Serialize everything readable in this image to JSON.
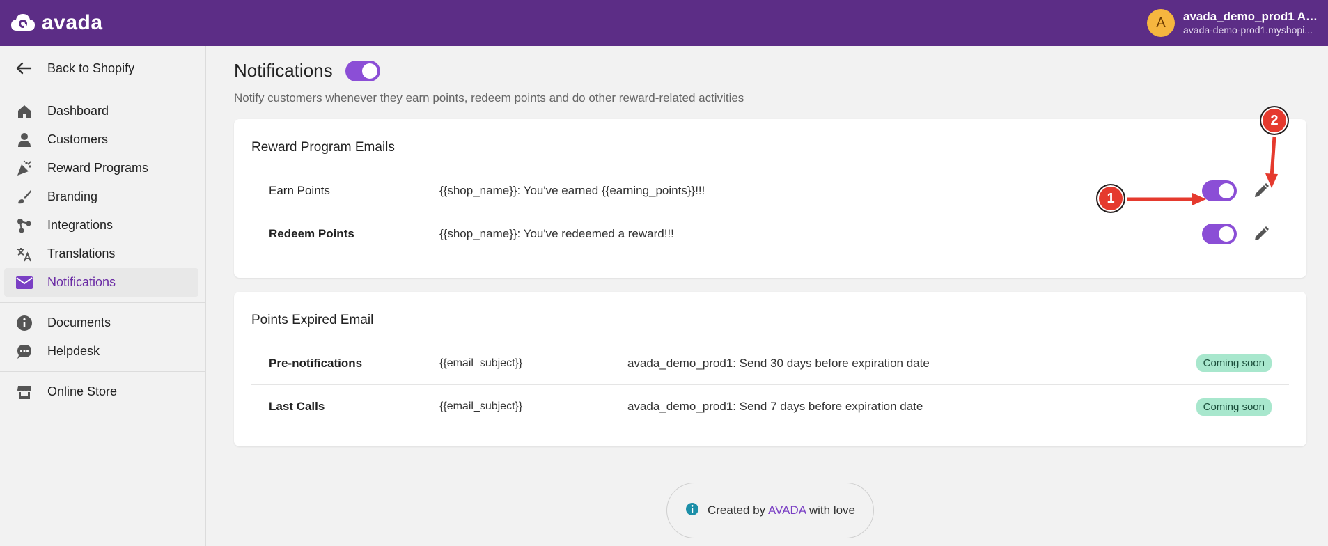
{
  "topbar": {
    "logo_text": "avada",
    "avatar_letter": "A",
    "account_name": "avada_demo_prod1 Ad...",
    "account_domain": "avada-demo-prod1.myshopi..."
  },
  "sidebar": {
    "back_label": "Back to Shopify",
    "items": [
      {
        "label": "Dashboard",
        "icon": "home-icon"
      },
      {
        "label": "Customers",
        "icon": "person-icon"
      },
      {
        "label": "Reward Programs",
        "icon": "confetti-icon"
      },
      {
        "label": "Branding",
        "icon": "brush-icon"
      },
      {
        "label": "Integrations",
        "icon": "integrations-icon"
      },
      {
        "label": "Translations",
        "icon": "translate-icon"
      },
      {
        "label": "Notifications",
        "icon": "mail-icon",
        "active": true
      }
    ],
    "secondary": [
      {
        "label": "Documents",
        "icon": "info-icon"
      },
      {
        "label": "Helpdesk",
        "icon": "chat-icon"
      }
    ],
    "store": {
      "label": "Online Store",
      "icon": "store-icon"
    }
  },
  "main": {
    "title": "Notifications",
    "title_toggle_on": true,
    "subtitle": "Notify customers whenever they earn points, redeem points and do other reward-related activities",
    "reward_card": {
      "title": "Reward Program Emails",
      "rows": [
        {
          "name": "Earn Points",
          "text": "{{shop_name}}: You've earned {{earning_points}}!!!",
          "enabled": true
        },
        {
          "name": "Redeem Points",
          "text": "{{shop_name}}: You've redeemed a reward!!!",
          "enabled": true
        }
      ]
    },
    "expired_card": {
      "title": "Points Expired Email",
      "rows": [
        {
          "name": "Pre-notifications",
          "subject": "{{email_subject}}",
          "text": "avada_demo_prod1: Send 30 days before expiration date",
          "badge": "Coming soon"
        },
        {
          "name": "Last Calls",
          "subject": "{{email_subject}}",
          "text": "avada_demo_prod1: Send 7 days before expiration date",
          "badge": "Coming soon"
        }
      ]
    }
  },
  "footer": {
    "prefix": "Created by",
    "link": "AVADA",
    "suffix": "with love"
  },
  "annotations": {
    "marker_1": "1",
    "marker_2": "2"
  },
  "colors": {
    "brand": "#5c2d86",
    "accent": "#8b4ed6",
    "badge": "#a8e7cd",
    "annotation": "#e53a2e"
  }
}
